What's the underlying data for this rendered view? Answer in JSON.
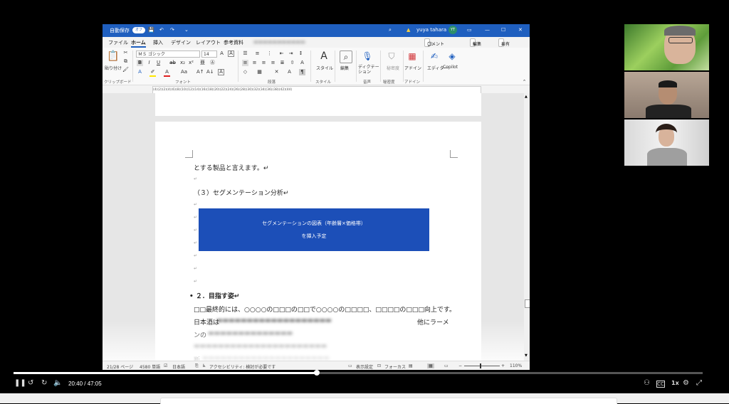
{
  "word": {
    "titlebar": {
      "autosave_label": "自動保存",
      "autosave_state": "オフ",
      "user_name": "yuya tahara",
      "user_initials": "YT"
    },
    "menu": {
      "tabs": [
        "ファイル",
        "ホーム",
        "挿入",
        "デザイン",
        "レイアウト",
        "参考資料"
      ],
      "comment_button": "コメント",
      "edit_button": "編集",
      "share_button": "共有"
    },
    "ribbon": {
      "paste_label": "貼り付け",
      "font_name": "ＭＳ ゴシック",
      "font_size": "14",
      "style_label": "スタイル",
      "editing_label": "編集",
      "dictation_label": "ディクテーション",
      "sensitivity_label": "秘密度",
      "addins_label": "アドイン",
      "editor_label": "エディター",
      "copilot_label": "Copilot",
      "groups": {
        "clipboard": "クリップボード",
        "font": "フォント",
        "paragraph": "段落",
        "style": "スタイル",
        "voice": "音声",
        "sensitivity": "秘密度",
        "addins": "アドイン"
      }
    },
    "ruler_text": "(4)(2)(2)(4)(6)(8)(10)(12)(14)(16)(18)(20)(22)(24)(26)(28)(30)(32)(34)(36)(38)(42)(44)",
    "document": {
      "line1": "とする製品と言えます。↵",
      "heading3": "（３）セグメンテーション分析↵",
      "figure_line1": "セグメンテーションの図表（年齢層×価格帯）",
      "figure_line2": "を挿入予定",
      "section2": "２．目指す姿↵",
      "para1": "□□最終的には、○○○○の□□□の□□で○○○○の□□□□、□□□□の□□□向上です。",
      "para2_start": "日本酒は",
      "para2_end": "他にラーメ",
      "para3_start": "ンの",
      "para4": "断",
      "return_mark": "↵"
    },
    "statusbar": {
      "page": "21/28 ページ",
      "words": "4580 単語",
      "language": "日本語",
      "accessibility": "アクセシビリティ: 検討が必要です",
      "display_settings": "表示設定",
      "focus": "フォーカス",
      "zoom": "110%"
    }
  },
  "player": {
    "time_current": "20:40",
    "time_total": "47:05",
    "time_display": "20:40 / 47:05",
    "speed": "1x",
    "progress_fraction": 0.44
  },
  "colors": {
    "word_blue": "#1f5fbf",
    "figure_blue": "#1c4fb8"
  }
}
